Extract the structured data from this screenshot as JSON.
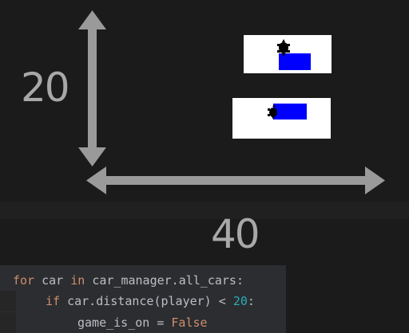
{
  "diagram": {
    "vertical_dimension_label": "20",
    "horizontal_dimension_label": "40",
    "arrow_color": "#9a9a9a",
    "car_color": "#0000ff",
    "turtle_color": "#000000",
    "panel_color": "#ffffff"
  },
  "code": {
    "line1": {
      "kw_for": "for",
      "var": " car ",
      "kw_in": "in",
      "expr": " car_manager.all_cars:"
    },
    "line2": {
      "kw_if": "if",
      "expr": " car.distance(player) < ",
      "num": "20",
      "colon": ":"
    },
    "line3": {
      "assign": "game_is_on = ",
      "value": "False"
    }
  }
}
